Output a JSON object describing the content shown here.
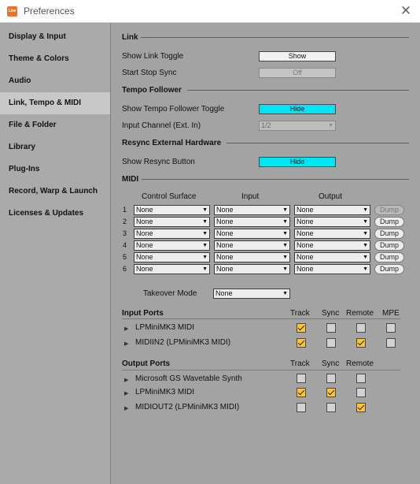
{
  "window": {
    "title": "Preferences",
    "icon_text": "Live",
    "close_glyph": "✕"
  },
  "sidebar": {
    "items": [
      {
        "label": "Display & Input"
      },
      {
        "label": "Theme & Colors"
      },
      {
        "label": "Audio"
      },
      {
        "label": "Link, Tempo & MIDI",
        "active": true
      },
      {
        "label": "File & Folder"
      },
      {
        "label": "Library"
      },
      {
        "label": "Plug-Ins"
      },
      {
        "label": "Record, Warp & Launch"
      },
      {
        "label": "Licenses & Updates"
      }
    ]
  },
  "link": {
    "section": "Link",
    "show_toggle_label": "Show Link Toggle",
    "show_toggle_value": "Show",
    "start_stop_label": "Start Stop Sync",
    "start_stop_value": "Off"
  },
  "tempo": {
    "section": "Tempo Follower",
    "show_toggle_label": "Show Tempo Follower Toggle",
    "show_toggle_value": "Hide",
    "input_channel_label": "Input Channel (Ext. In)",
    "input_channel_value": "1/2"
  },
  "resync": {
    "section": "Resync External Hardware",
    "show_button_label": "Show Resync Button",
    "show_button_value": "Hide"
  },
  "midi": {
    "section": "MIDI",
    "col_control_surface": "Control Surface",
    "col_input": "Input",
    "col_output": "Output",
    "dump_label": "Dump",
    "rows": [
      {
        "num": "1",
        "surface": "None",
        "input": "None",
        "output": "None"
      },
      {
        "num": "2",
        "surface": "None",
        "input": "None",
        "output": "None"
      },
      {
        "num": "3",
        "surface": "None",
        "input": "None",
        "output": "None"
      },
      {
        "num": "4",
        "surface": "None",
        "input": "None",
        "output": "None"
      },
      {
        "num": "5",
        "surface": "None",
        "input": "None",
        "output": "None"
      },
      {
        "num": "6",
        "surface": "None",
        "input": "None",
        "output": "None"
      }
    ],
    "takeover_label": "Takeover Mode",
    "takeover_value": "None"
  },
  "input_ports": {
    "header": "Input Ports",
    "col_track": "Track",
    "col_sync": "Sync",
    "col_remote": "Remote",
    "col_mpe": "MPE",
    "ports": [
      {
        "name": "LPMiniMK3 MIDI",
        "track": true,
        "sync": false,
        "remote": false,
        "mpe": false
      },
      {
        "name": "MIDIIN2 (LPMiniMK3 MIDI)",
        "track": true,
        "sync": false,
        "remote": true,
        "mpe": false
      }
    ]
  },
  "output_ports": {
    "header": "Output Ports",
    "col_track": "Track",
    "col_sync": "Sync",
    "col_remote": "Remote",
    "ports": [
      {
        "name": "Microsoft GS Wavetable Synth",
        "track": false,
        "sync": false,
        "remote": false
      },
      {
        "name": "LPMiniMK3 MIDI",
        "track": true,
        "sync": true,
        "remote": false
      },
      {
        "name": "MIDIOUT2 (LPMiniMK3 MIDI)",
        "track": false,
        "sync": false,
        "remote": true
      }
    ]
  },
  "colors": {
    "accent_cyan": "#00e4f4",
    "checkbox_on": "#ffc430",
    "sidebar_active": "#c8c8c8"
  }
}
